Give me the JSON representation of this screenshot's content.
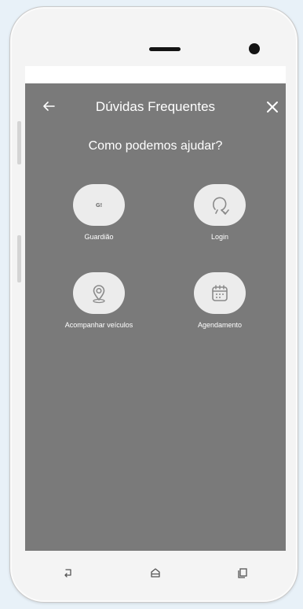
{
  "header": {
    "title": "Dúvidas Frequentes",
    "back_icon": "arrow-left-icon",
    "close_icon": "close-icon"
  },
  "subtitle": "Como podemos ajudar?",
  "topics": [
    {
      "label": "Guardião",
      "icon": "guardiao-logo-icon",
      "icon_text": "G!"
    },
    {
      "label": "Login",
      "icon": "user-check-icon"
    },
    {
      "label": "Acompanhar veículos",
      "icon": "location-pin-icon"
    },
    {
      "label": "Agendamento",
      "icon": "calendar-icon"
    }
  ],
  "nav_bar": {
    "icons": [
      "back-icon",
      "home-icon",
      "recent-apps-icon"
    ]
  },
  "colors": {
    "screen_background": "#7a7a7a",
    "tile_background": "#ececec",
    "icon_stroke": "#8a8a8a",
    "text": "#ffffff"
  }
}
